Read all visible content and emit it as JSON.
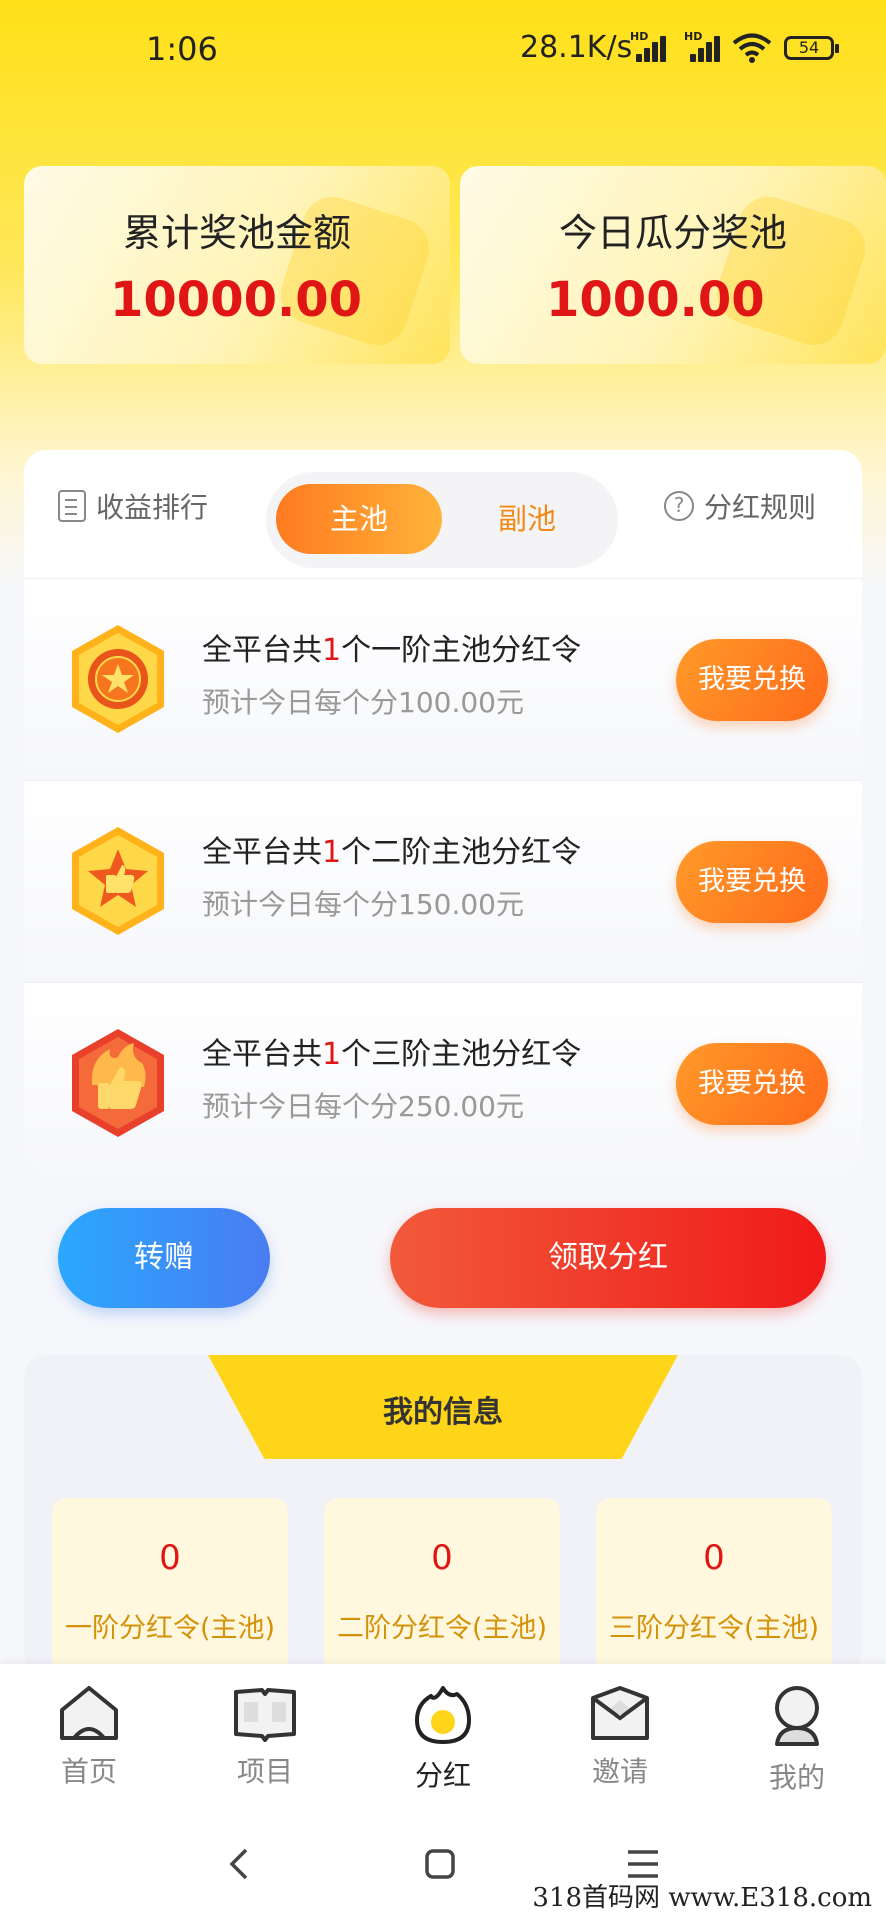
{
  "status_bar": {
    "time": "1:06",
    "net_speed": "28.1K/s",
    "hd1": "HD",
    "hd2": "HD",
    "battery": "54"
  },
  "pools": {
    "total": {
      "label": "累计奖池金额",
      "amount": "10000.00"
    },
    "today": {
      "label": "今日瓜分奖池",
      "amount": "1000.00"
    }
  },
  "panel": {
    "ranking_label": "收益排行",
    "tabs": [
      {
        "label": "主池",
        "active": true
      },
      {
        "label": "副池",
        "active": false
      }
    ],
    "rules_label": "分红规则",
    "rows": [
      {
        "pre": "全平台共",
        "count": "1",
        "post": "个一阶主池分红令",
        "sub": "预计今日每个分100.00元",
        "button": "我要兑换",
        "icon": "star-badge-icon"
      },
      {
        "pre": "全平台共",
        "count": "1",
        "post": "个二阶主池分红令",
        "sub": "预计今日每个分150.00元",
        "button": "我要兑换",
        "icon": "thumbs-up-badge-icon"
      },
      {
        "pre": "全平台共",
        "count": "1",
        "post": "个三阶主池分红令",
        "sub": "预计今日每个分250.00元",
        "button": "我要兑换",
        "icon": "fire-thumbs-badge-icon"
      }
    ]
  },
  "actions": {
    "gift": "转赠",
    "claim": "领取分红"
  },
  "my_info": {
    "title": "我的信息",
    "stats": [
      {
        "value": "0",
        "label": "一阶分红令(主池)"
      },
      {
        "value": "0",
        "label": "二阶分红令(主池)"
      },
      {
        "value": "0",
        "label": "三阶分红令(主池)"
      }
    ]
  },
  "nav": [
    {
      "label": "首页",
      "icon": "home-icon"
    },
    {
      "label": "项目",
      "icon": "book-icon"
    },
    {
      "label": "分红",
      "icon": "flame-icon",
      "active": true
    },
    {
      "label": "邀请",
      "icon": "invite-icon"
    },
    {
      "label": "我的",
      "icon": "profile-icon"
    }
  ],
  "watermark": "318首码网  www.E318.com",
  "colors": {
    "accent_yellow": "#ffd51a",
    "accent_orange": "#ff7a1f",
    "amount_red": "#e01616",
    "gift_blue": "#4a7cf0"
  }
}
